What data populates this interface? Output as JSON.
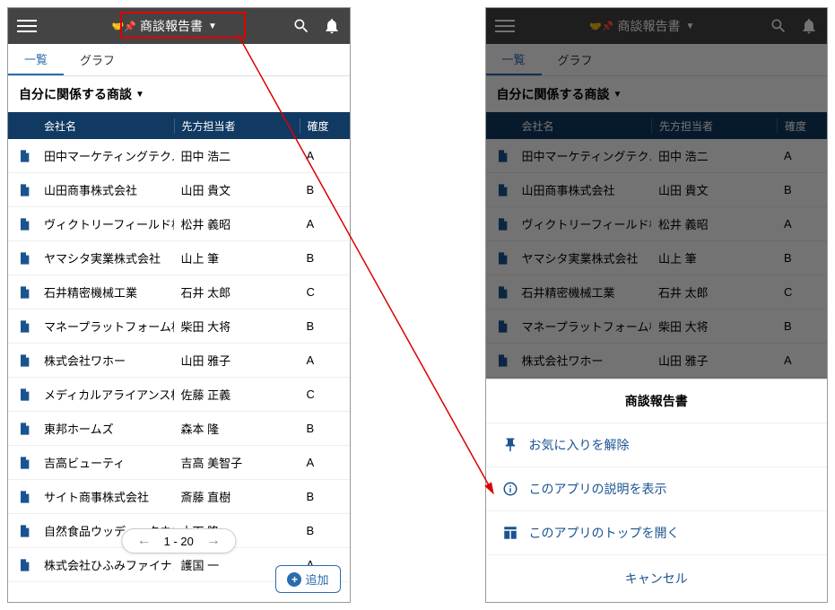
{
  "app_title": "商談報告書",
  "tabs": [
    "一覧",
    "グラフ"
  ],
  "filter": "自分に関係する商談",
  "columns": {
    "company": "会社名",
    "contact": "先方担当者",
    "rank": "確度"
  },
  "rows": [
    {
      "company": "田中マーケティングテクノ",
      "contact": "田中 浩二",
      "rank": "A"
    },
    {
      "company": "山田商事株式会社",
      "contact": "山田 貴文",
      "rank": "B"
    },
    {
      "company": "ヴィクトリーフィールド株",
      "contact": "松井 義昭",
      "rank": "A"
    },
    {
      "company": "ヤマシタ実業株式会社",
      "contact": "山上 筆",
      "rank": "B"
    },
    {
      "company": "石井精密機械工業",
      "contact": "石井 太郎",
      "rank": "C"
    },
    {
      "company": "マネープラットフォーム株",
      "contact": "柴田 大将",
      "rank": "B"
    },
    {
      "company": "株式会社ワホー",
      "contact": "山田 雅子",
      "rank": "A"
    },
    {
      "company": "メディカルアライアンス株",
      "contact": "佐藤 正義",
      "rank": "C"
    },
    {
      "company": "東邦ホームズ",
      "contact": "森本 隆",
      "rank": "B"
    },
    {
      "company": "吉高ビューティ",
      "contact": "吉高 美智子",
      "rank": "A"
    },
    {
      "company": "サイト商事株式会社",
      "contact": "斎藤 直樹",
      "rank": "B"
    },
    {
      "company": "自然食品ウッディータウン",
      "contact": "木下 隆",
      "rank": "B"
    },
    {
      "company": "株式会社ひふみファイナン",
      "contact": "護国 一",
      "rank": "A"
    }
  ],
  "rows_right_count": 7,
  "pager": "1 - 20",
  "add_label": "追加",
  "sheet": {
    "title": "商談報告書",
    "unfavorite": "お気に入りを解除",
    "desc": "このアプリの説明を表示",
    "top": "このアプリのトップを開く",
    "cancel": "キャンセル"
  }
}
